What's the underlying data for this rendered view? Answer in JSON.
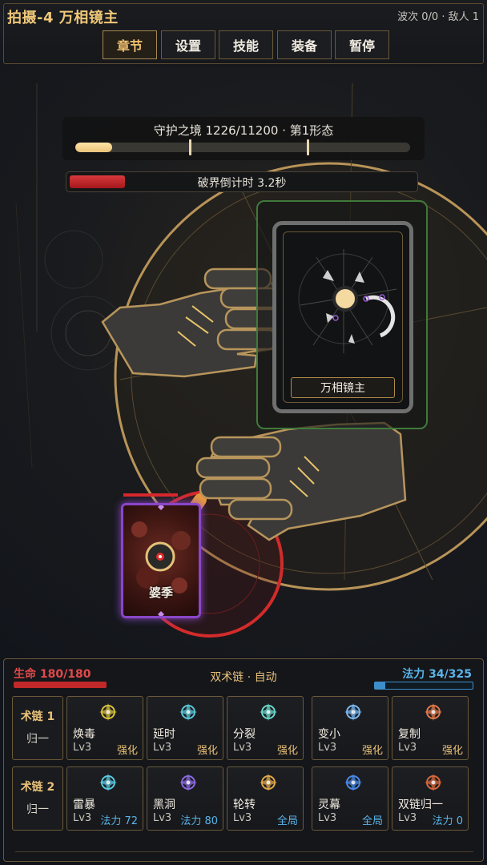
{
  "header": {
    "stage_title": "拍摄-4 万相镜主",
    "wave_info": "波次 0/0 · 敌人 1",
    "tabs": [
      {
        "label": "章节",
        "active": true
      },
      {
        "label": "设置",
        "active": false
      },
      {
        "label": "技能",
        "active": false
      },
      {
        "label": "装备",
        "active": false
      },
      {
        "label": "暂停",
        "active": false
      }
    ]
  },
  "boss": {
    "status_text": "守护之境  1226/11200  ·  第1形态",
    "hp_current": 1226,
    "hp_max": 11200,
    "card_name": "万相镜主"
  },
  "break_timer": {
    "text": "破界倒计时  3.2秒",
    "fill_fraction": 0.16
  },
  "hero": {
    "name": "婆季",
    "hp_fraction": 1.0
  },
  "player": {
    "hp_label": "生命 180/180",
    "hp_fraction": 1.0,
    "chain_mode": "双术链  ·  自动",
    "mp_label": "法力 34/325",
    "mp_fraction": 0.105
  },
  "chains": [
    {
      "title": "术链 1",
      "subtitle": "归一",
      "skills": [
        {
          "name": "焕毒",
          "level": "Lv3",
          "tag": "强化",
          "tag_color": "gold",
          "icon": "poison-rune-icon",
          "color": "#d8c23a"
        },
        {
          "name": "延时",
          "level": "Lv3",
          "tag": "强化",
          "tag_color": "gold",
          "icon": "delay-crystal-icon",
          "color": "#5ac8d8"
        },
        {
          "name": "分裂",
          "level": "Lv3",
          "tag": "强化",
          "tag_color": "gold",
          "icon": "split-icon",
          "color": "#6ad8c8"
        },
        {
          "name": "变小",
          "level": "Lv3",
          "tag": "强化",
          "tag_color": "gold",
          "icon": "shrink-star-icon",
          "color": "#7ab8f0"
        },
        {
          "name": "复制",
          "level": "Lv3",
          "tag": "强化",
          "tag_color": "gold",
          "icon": "copy-gem-icon",
          "color": "#e07a4a"
        }
      ]
    },
    {
      "title": "术链 2",
      "subtitle": "归一",
      "skills": [
        {
          "name": "雷暴",
          "level": "Lv3",
          "tag": "法力 72",
          "tag_color": "blue",
          "icon": "thunder-icon",
          "color": "#5ac8e0"
        },
        {
          "name": "黑洞",
          "level": "Lv3",
          "tag": "法力 80",
          "tag_color": "blue",
          "icon": "black-hole-icon",
          "color": "#8a6ae0"
        },
        {
          "name": "轮转",
          "level": "Lv3",
          "tag": "全局",
          "tag_color": "blue",
          "icon": "rotation-icon",
          "color": "#e0a84a"
        },
        {
          "name": "灵幕",
          "level": "Lv3",
          "tag": "全局",
          "tag_color": "blue",
          "icon": "spirit-curtain-icon",
          "color": "#4a8ae8"
        },
        {
          "name": "双链归一",
          "level": "Lv3",
          "tag": "法力 0",
          "tag_color": "blue",
          "icon": "dual-chain-icon",
          "color": "#d8683a"
        }
      ]
    }
  ]
}
